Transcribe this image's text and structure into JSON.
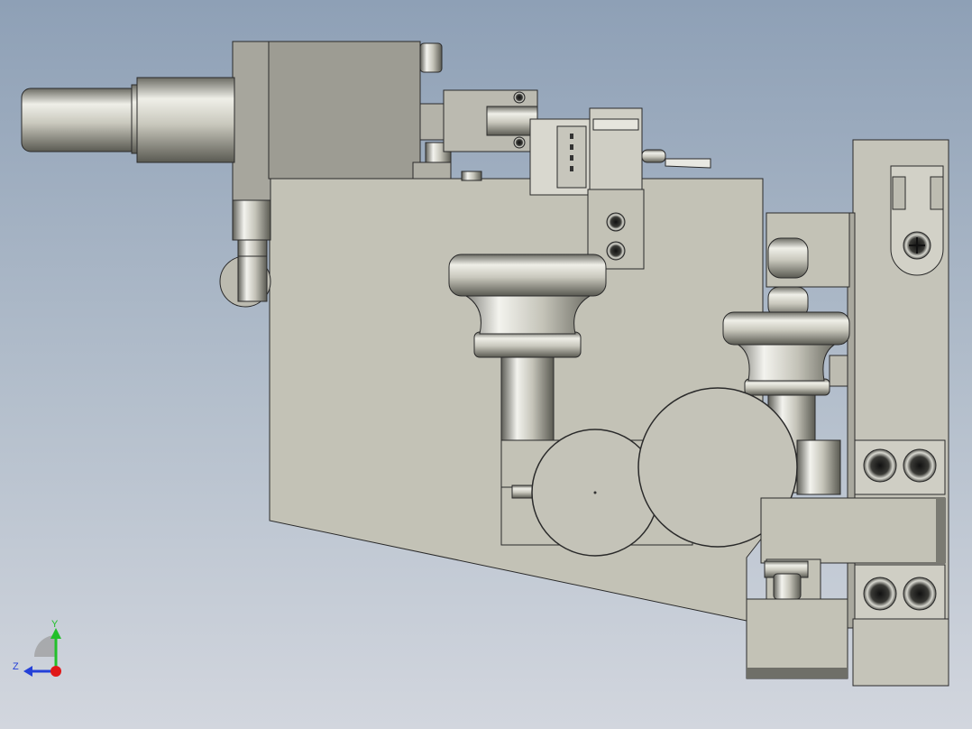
{
  "viewport": {
    "background_top": "#8ea0b6",
    "background_bottom": "#d2d6de"
  },
  "colors": {
    "body_grey": "#c3c2b6",
    "dark_grey": "#9c9b92",
    "outline": "#2a2a2a",
    "steel_light": "#f2f2ee",
    "steel_dark": "#5e5e58"
  },
  "triad": {
    "y_label": "Y",
    "z_label": "Z",
    "y_color": "#22c02a",
    "z_color": "#2440d8",
    "origin_color": "#e01818"
  }
}
